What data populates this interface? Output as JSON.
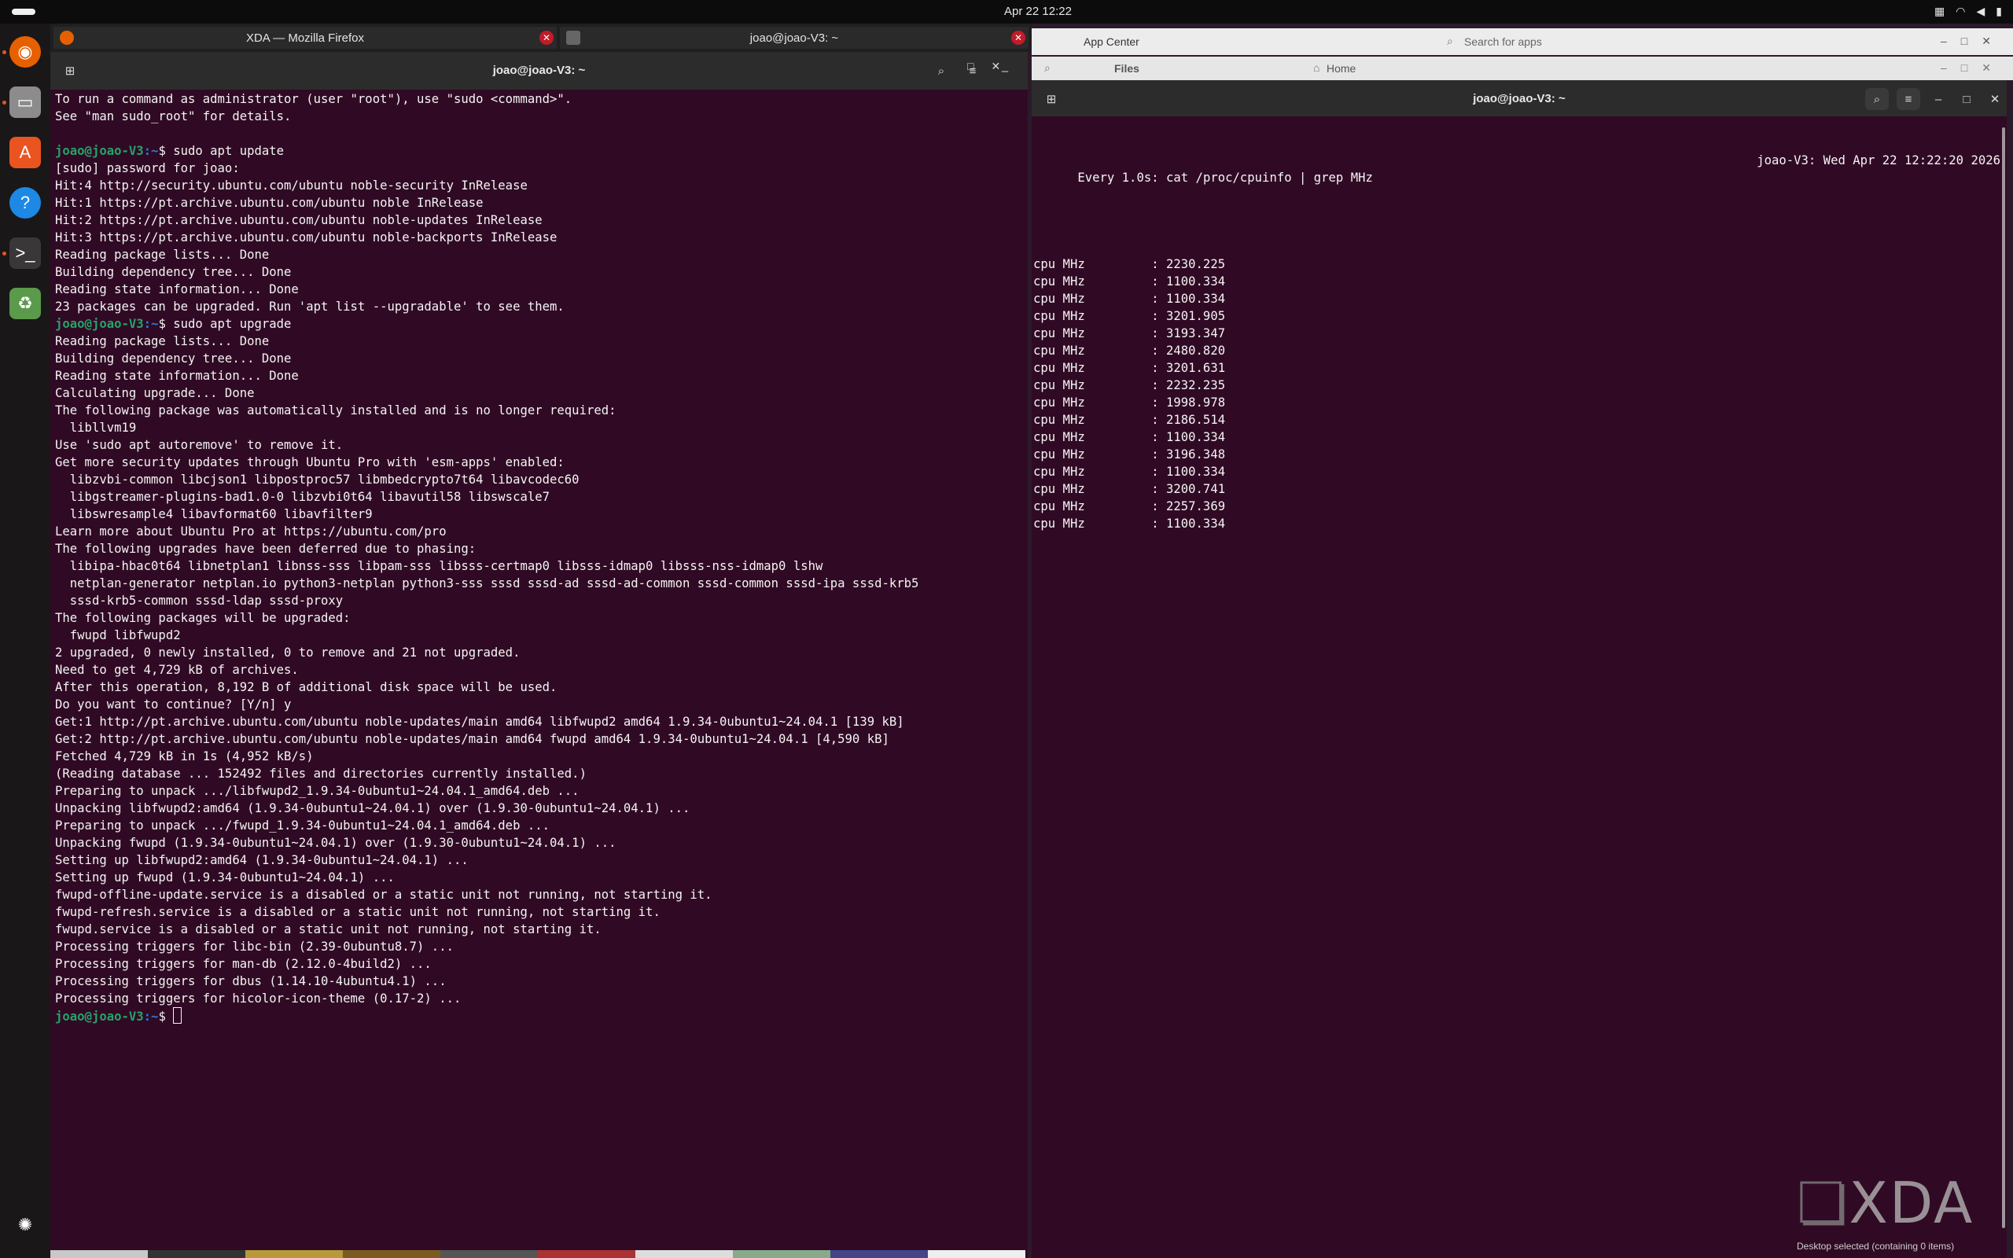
{
  "top_bar": {
    "clock": "Apr 22  12:22"
  },
  "dock": {
    "items": [
      {
        "name": "firefox-icon",
        "glyph": "◉",
        "color": "#e66000"
      },
      {
        "name": "files-icon",
        "glyph": "▭",
        "color": "#8c8c8c"
      },
      {
        "name": "app-center-icon",
        "glyph": "A",
        "color": "#e95420"
      },
      {
        "name": "help-icon",
        "glyph": "?",
        "color": "#1e88e5"
      },
      {
        "name": "terminal-icon",
        "glyph": ">_",
        "color": "#2d2d2d"
      },
      {
        "name": "trash-icon",
        "glyph": "♻",
        "color": "#5a9a4a"
      }
    ],
    "show_apps_glyph": "✺"
  },
  "tabs": {
    "firefox_label": "XDA — Mozilla Firefox",
    "terminal_label": "joao@joao-V3: ~"
  },
  "background_windows": {
    "app_center_label": "App Center",
    "search_placeholder": "Search for apps",
    "files_label": "Files",
    "home_label": "Home",
    "status": "Desktop  selected  (containing 0 items)"
  },
  "left_terminal": {
    "title": "joao@joao-V3: ~",
    "lines": [
      {
        "text": "To run a command as administrator (user \"root\"), use \"sudo <command>\"."
      },
      {
        "text": "See \"man sudo_root\" for details."
      },
      {
        "text": ""
      },
      {
        "prompt": "joao@joao-V3",
        "path": ":~",
        "cmd": "$ sudo apt update"
      },
      {
        "text": "[sudo] password for joao:"
      },
      {
        "text": "Hit:4 http://security.ubuntu.com/ubuntu noble-security InRelease"
      },
      {
        "text": "Hit:1 https://pt.archive.ubuntu.com/ubuntu noble InRelease"
      },
      {
        "text": "Hit:2 https://pt.archive.ubuntu.com/ubuntu noble-updates InRelease"
      },
      {
        "text": "Hit:3 https://pt.archive.ubuntu.com/ubuntu noble-backports InRelease"
      },
      {
        "text": "Reading package lists... Done"
      },
      {
        "text": "Building dependency tree... Done"
      },
      {
        "text": "Reading state information... Done"
      },
      {
        "text": "23 packages can be upgraded. Run 'apt list --upgradable' to see them."
      },
      {
        "prompt": "joao@joao-V3",
        "path": ":~",
        "cmd": "$ sudo apt upgrade"
      },
      {
        "text": "Reading package lists... Done"
      },
      {
        "text": "Building dependency tree... Done"
      },
      {
        "text": "Reading state information... Done"
      },
      {
        "text": "Calculating upgrade... Done"
      },
      {
        "text": "The following package was automatically installed and is no longer required:"
      },
      {
        "text": "  libllvm19"
      },
      {
        "text": "Use 'sudo apt autoremove' to remove it."
      },
      {
        "text": "Get more security updates through Ubuntu Pro with 'esm-apps' enabled:"
      },
      {
        "text": "  libzvbi-common libcjson1 libpostproc57 libmbedcrypto7t64 libavcodec60"
      },
      {
        "text": "  libgstreamer-plugins-bad1.0-0 libzvbi0t64 libavutil58 libswscale7"
      },
      {
        "text": "  libswresample4 libavformat60 libavfilter9"
      },
      {
        "text": "Learn more about Ubuntu Pro at https://ubuntu.com/pro"
      },
      {
        "text": "The following upgrades have been deferred due to phasing:"
      },
      {
        "text": "  libipa-hbac0t64 libnetplan1 libnss-sss libpam-sss libsss-certmap0 libsss-idmap0 libsss-nss-idmap0 lshw"
      },
      {
        "text": "  netplan-generator netplan.io python3-netplan python3-sss sssd sssd-ad sssd-ad-common sssd-common sssd-ipa sssd-krb5"
      },
      {
        "text": "  sssd-krb5-common sssd-ldap sssd-proxy"
      },
      {
        "text": "The following packages will be upgraded:"
      },
      {
        "text": "  fwupd libfwupd2"
      },
      {
        "text": "2 upgraded, 0 newly installed, 0 to remove and 21 not upgraded."
      },
      {
        "text": "Need to get 4,729 kB of archives."
      },
      {
        "text": "After this operation, 8,192 B of additional disk space will be used."
      },
      {
        "text": "Do you want to continue? [Y/n] y"
      },
      {
        "text": "Get:1 http://pt.archive.ubuntu.com/ubuntu noble-updates/main amd64 libfwupd2 amd64 1.9.34-0ubuntu1~24.04.1 [139 kB]"
      },
      {
        "text": "Get:2 http://pt.archive.ubuntu.com/ubuntu noble-updates/main amd64 fwupd amd64 1.9.34-0ubuntu1~24.04.1 [4,590 kB]"
      },
      {
        "text": "Fetched 4,729 kB in 1s (4,952 kB/s)"
      },
      {
        "text": "(Reading database ... 152492 files and directories currently installed.)"
      },
      {
        "text": "Preparing to unpack .../libfwupd2_1.9.34-0ubuntu1~24.04.1_amd64.deb ..."
      },
      {
        "text": "Unpacking libfwupd2:amd64 (1.9.34-0ubuntu1~24.04.1) over (1.9.30-0ubuntu1~24.04.1) ..."
      },
      {
        "text": "Preparing to unpack .../fwupd_1.9.34-0ubuntu1~24.04.1_amd64.deb ..."
      },
      {
        "text": "Unpacking fwupd (1.9.34-0ubuntu1~24.04.1) over (1.9.30-0ubuntu1~24.04.1) ..."
      },
      {
        "text": "Setting up libfwupd2:amd64 (1.9.34-0ubuntu1~24.04.1) ..."
      },
      {
        "text": "Setting up fwupd (1.9.34-0ubuntu1~24.04.1) ..."
      },
      {
        "text": "fwupd-offline-update.service is a disabled or a static unit not running, not starting it."
      },
      {
        "text": "fwupd-refresh.service is a disabled or a static unit not running, not starting it."
      },
      {
        "text": "fwupd.service is a disabled or a static unit not running, not starting it."
      },
      {
        "text": "Processing triggers for libc-bin (2.39-0ubuntu8.7) ..."
      },
      {
        "text": "Processing triggers for man-db (2.12.0-4build2) ..."
      },
      {
        "text": "Processing triggers for dbus (1.14.10-4ubuntu4.1) ..."
      },
      {
        "text": "Processing triggers for hicolor-icon-theme (0.17-2) ..."
      },
      {
        "prompt": "joao@joao-V3",
        "path": ":~",
        "cmd": "$ ",
        "cursor": true
      }
    ]
  },
  "right_terminal": {
    "title": "joao@joao-V3: ~",
    "watch_header_left": "Every 1.0s: cat /proc/cpuinfo | grep MHz",
    "watch_header_right": "joao-V3: Wed Apr 22 12:22:20 2026",
    "cpu_label": "cpu MHz",
    "cpu_values": [
      "2230.225",
      "1100.334",
      "1100.334",
      "3201.905",
      "3193.347",
      "2480.820",
      "3201.631",
      "2232.235",
      "1998.978",
      "2186.514",
      "1100.334",
      "3196.348",
      "1100.334",
      "3200.741",
      "2257.369",
      "1100.334"
    ]
  },
  "watermark": {
    "mark": "❏",
    "text": "XDA"
  }
}
